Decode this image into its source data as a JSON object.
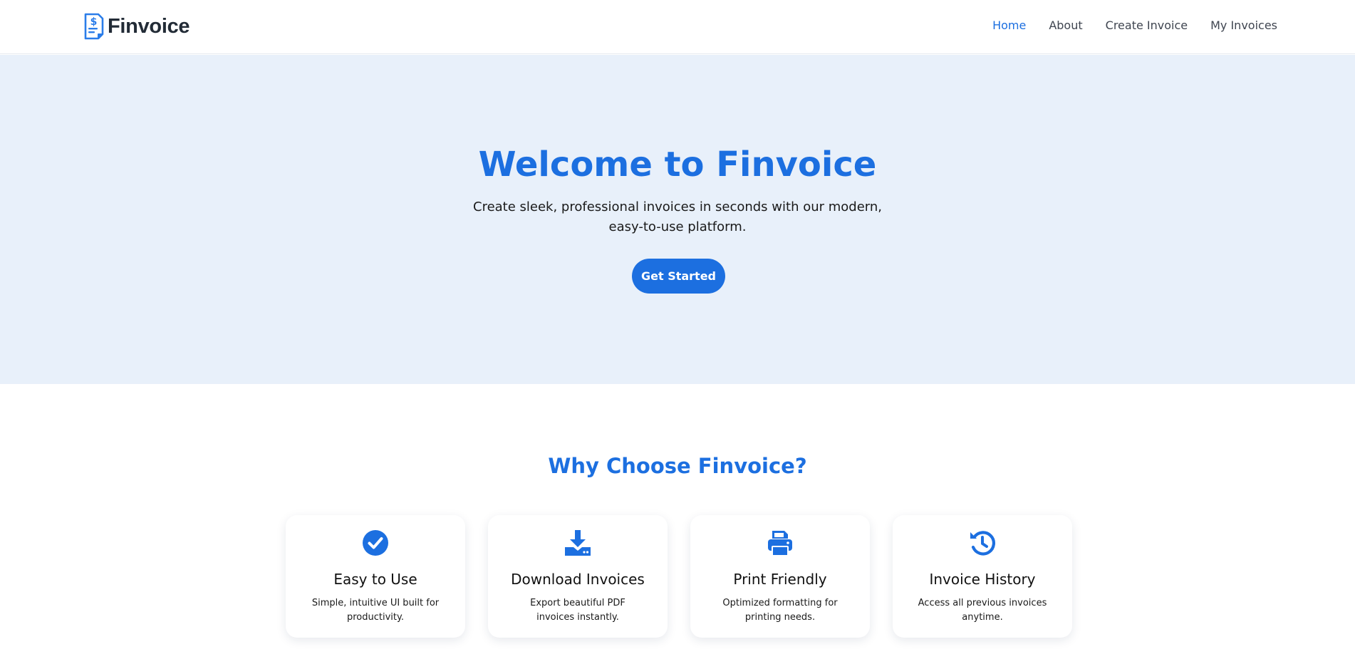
{
  "brand": {
    "name": "Finvoice",
    "icon": "invoice-dollar-icon"
  },
  "nav": {
    "items": [
      {
        "label": "Home",
        "active": true
      },
      {
        "label": "About",
        "active": false
      },
      {
        "label": "Create Invoice",
        "active": false
      },
      {
        "label": "My Invoices",
        "active": false
      }
    ]
  },
  "hero": {
    "title": "Welcome to Finvoice",
    "subtitle": "Create sleek, professional invoices in seconds with our modern, easy-to-use platform.",
    "cta_label": "Get Started"
  },
  "features": {
    "title": "Why Choose Finvoice?",
    "cards": [
      {
        "icon": "check-circle-icon",
        "title": "Easy to Use",
        "description": "Simple, intuitive UI built for productivity."
      },
      {
        "icon": "download-icon",
        "title": "Download Invoices",
        "description": "Export beautiful PDF invoices instantly."
      },
      {
        "icon": "printer-icon",
        "title": "Print Friendly",
        "description": "Optimized formatting for printing needs."
      },
      {
        "icon": "history-icon",
        "title": "Invoice History",
        "description": "Access all previous invoices anytime."
      }
    ]
  },
  "colors": {
    "accent": "#1c6fe0",
    "hero_background": "#e8f0fa",
    "brand_text": "#222b36",
    "nav_text": "#3f4550"
  }
}
